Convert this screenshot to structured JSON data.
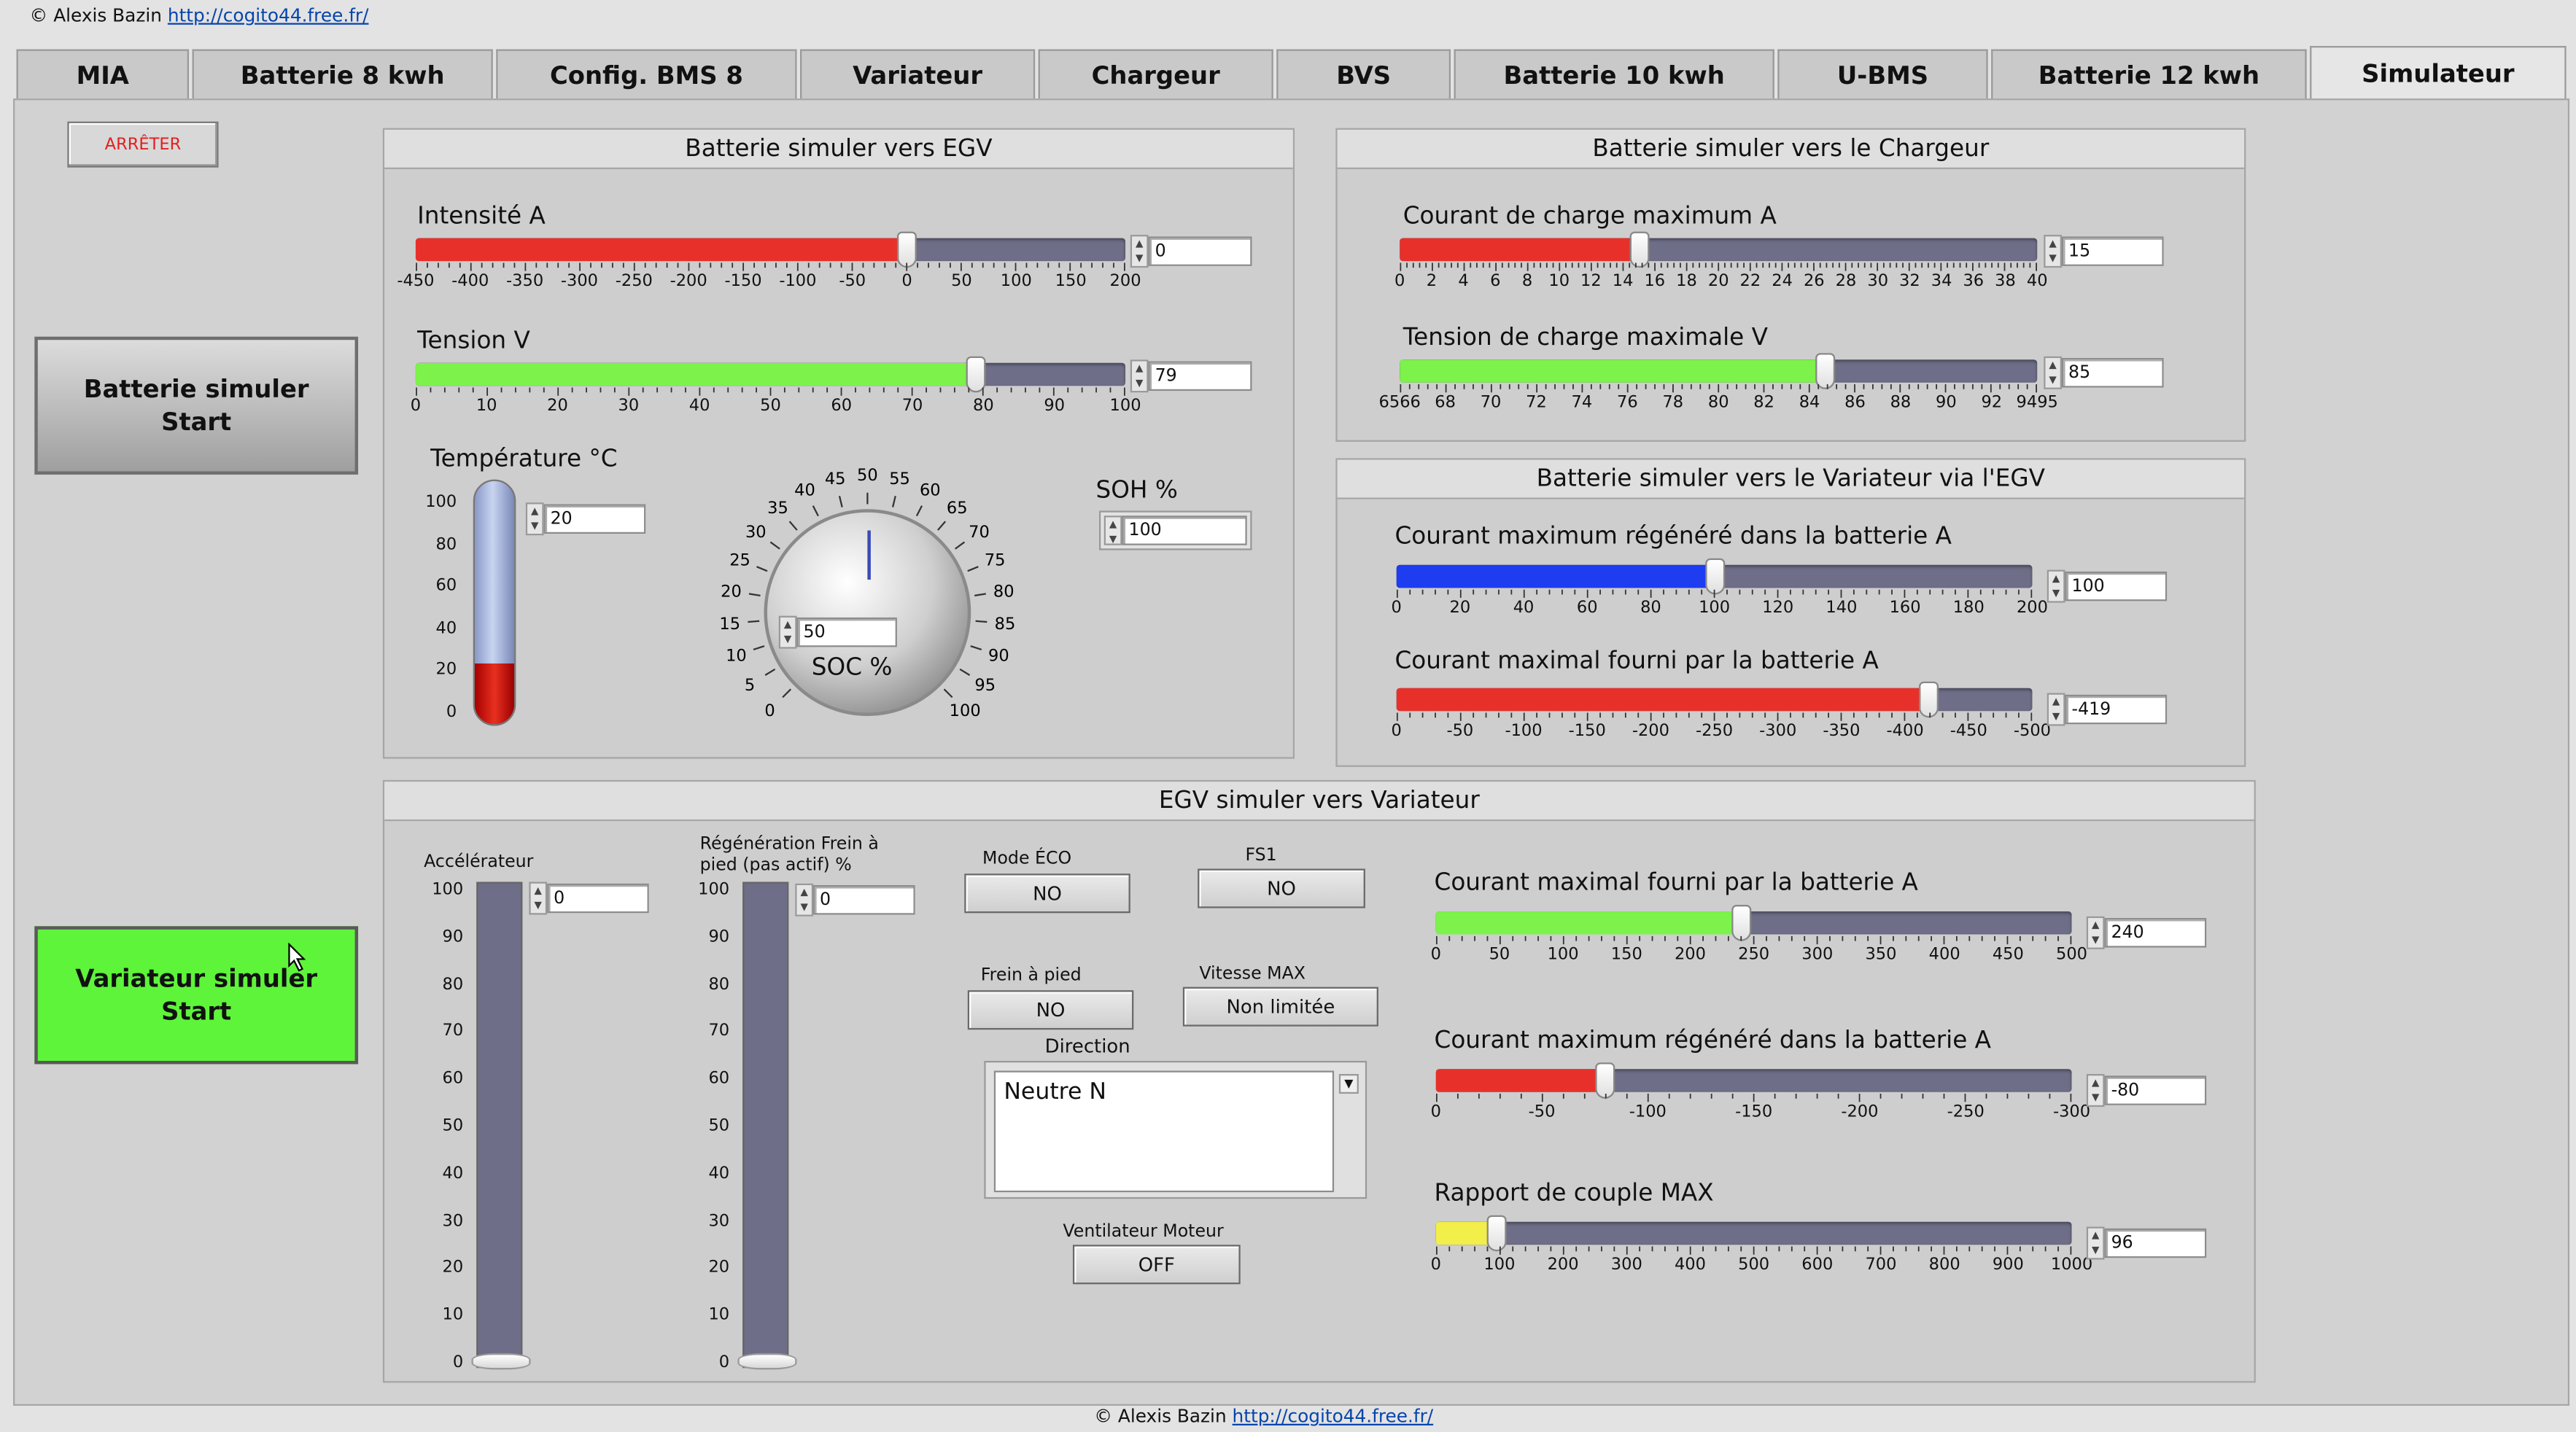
{
  "credit": {
    "prefix": "© Alexis Bazin",
    "link": "http://cogito44.free.fr/"
  },
  "tabs": [
    "MIA",
    "Batterie 8 kwh",
    "Config. BMS  8",
    "Variateur",
    "Chargeur",
    "BVS",
    "Batterie 10 kwh",
    "U-BMS",
    "Batterie 12 kwh",
    "Simulateur"
  ],
  "active_tab": "Simulateur",
  "stop_label": "ARRÊTER",
  "battery_start": {
    "line1": "Batterie simuler",
    "line2": "Start"
  },
  "variator_start": {
    "line1": "Variateur simuler",
    "line2": "Start"
  },
  "colors": {
    "red": "#e8302a",
    "green": "#7cf24a",
    "blue": "#1e3cf0",
    "yellow": "#f2ee4a",
    "track": "#6e6e88",
    "start_green": "#5ef43a"
  },
  "egv": {
    "title": "Batterie simuler vers EGV",
    "intensite": {
      "label": "Intensité A",
      "value": "0",
      "min": -450,
      "max": 200,
      "fill": 0,
      "ticks": [
        "-450",
        "-400",
        "-350",
        "-300",
        "-250",
        "-200",
        "-150",
        "-100",
        "-50",
        "0",
        "50",
        "100",
        "150",
        "200"
      ]
    },
    "tension": {
      "label": "Tension V",
      "value": "79",
      "min": 0,
      "max": 100,
      "fill": 79,
      "ticks": [
        "0",
        "10",
        "20",
        "30",
        "40",
        "50",
        "60",
        "70",
        "80",
        "90",
        "100"
      ]
    },
    "temperature": {
      "label": "Température °C",
      "value": "20",
      "ticks": [
        "100",
        "80",
        "60",
        "40",
        "20",
        "0"
      ],
      "level": 20
    },
    "soc": {
      "label": "SOC %",
      "value": "50",
      "ticks": [
        "0",
        "5",
        "10",
        "15",
        "20",
        "25",
        "30",
        "35",
        "40",
        "45",
        "50",
        "55",
        "60",
        "65",
        "70",
        "75",
        "80",
        "85",
        "90",
        "95",
        "100"
      ]
    },
    "soh": {
      "label": "SOH %",
      "value": "100"
    }
  },
  "chargeur": {
    "title": "Batterie simuler vers le Chargeur",
    "courant": {
      "label": "Courant de charge maximum A",
      "value": "15",
      "min": 0,
      "max": 40,
      "fill": 15,
      "ticks": [
        "0",
        "2",
        "4",
        "6",
        "8",
        "10",
        "12",
        "14",
        "16",
        "18",
        "20",
        "22",
        "24",
        "26",
        "28",
        "30",
        "32",
        "34",
        "36",
        "38",
        "40"
      ]
    },
    "tension": {
      "label": "Tension de charge maximale V",
      "value": "85",
      "min": 65,
      "max": 95,
      "fill": 85,
      "ticks": [
        "6566",
        "68",
        "70",
        "72",
        "74",
        "76",
        "78",
        "80",
        "82",
        "84",
        "86",
        "88",
        "90",
        "92",
        "9495"
      ]
    }
  },
  "variateur_egv": {
    "title": "Batterie simuler vers le Variateur via l'EGV",
    "regen": {
      "label": "Courant maximum régénéré dans la batterie A",
      "value": "100",
      "min": 0,
      "max": 200,
      "fill": 100,
      "ticks": [
        "0",
        "20",
        "40",
        "60",
        "80",
        "100",
        "120",
        "140",
        "160",
        "180",
        "200"
      ]
    },
    "fourni": {
      "label": "Courant maximal fourni par la batterie A",
      "value": "-419",
      "min": 0,
      "max": -500,
      "fill": -419,
      "ticks": [
        "0",
        "-50",
        "-100",
        "-150",
        "-200",
        "-250",
        "-300",
        "-350",
        "-400",
        "-450",
        "-500"
      ]
    }
  },
  "egv_var": {
    "title": "EGV simuler vers Variateur",
    "accel": {
      "label": "Accélérateur",
      "value": "0",
      "level": 0
    },
    "regen_frein": {
      "label_line1": "Régénération Frein à",
      "label_line2": "pied (pas actif) %",
      "value": "0",
      "level": 0
    },
    "vticks": [
      "100",
      "90",
      "80",
      "70",
      "60",
      "50",
      "40",
      "30",
      "20",
      "10",
      "0"
    ],
    "mode_eco": {
      "label": "Mode ÉCO",
      "value": "NO"
    },
    "fs1": {
      "label": "FS1",
      "value": "NO"
    },
    "frein": {
      "label": "Frein à pied",
      "value": "NO"
    },
    "vitesse": {
      "label": "Vitesse MAX",
      "value": "Non limitée"
    },
    "direction": {
      "label": "Direction",
      "value": "Neutre N"
    },
    "ventilateur": {
      "label": "Ventilateur Moteur",
      "value": "OFF"
    },
    "fourni": {
      "label": "Courant maximal fourni par la batterie A",
      "value": "240",
      "min": 0,
      "max": 500,
      "fill": 240,
      "ticks": [
        "0",
        "50",
        "100",
        "150",
        "200",
        "250",
        "300",
        "350",
        "400",
        "450",
        "500"
      ]
    },
    "regen": {
      "label": "Courant maximum régénéré dans la batterie A",
      "value": "-80",
      "min": 0,
      "max": -300,
      "fill": -80,
      "ticks": [
        "0",
        "-50",
        "-100",
        "-150",
        "-200",
        "-250",
        "-300"
      ]
    },
    "couple": {
      "label": "Rapport de couple MAX",
      "value": "96",
      "min": 0,
      "max": 1000,
      "fill": 96,
      "ticks": [
        "0",
        "100",
        "200",
        "300",
        "400",
        "500",
        "600",
        "700",
        "800",
        "900",
        "1000"
      ]
    }
  }
}
